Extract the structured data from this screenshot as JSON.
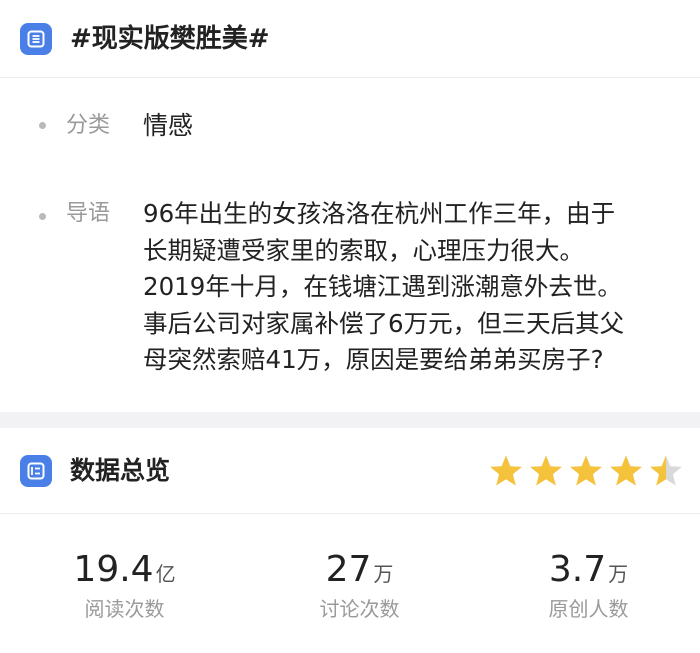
{
  "topic": {
    "title": "#现实版樊胜美#",
    "icon": "document-list-icon",
    "accent_color": "#4a7fe8"
  },
  "category": {
    "label": "分类",
    "value": "情感"
  },
  "intro": {
    "label": "导语",
    "lines": [
      "96年出生的女孩洛洛在杭州工作三年，由于",
      "长期疑遭受家里的索取，心理压力很大。",
      "2019年十月，在钱塘江遇到涨潮意外去世。",
      "事后公司对家属补偿了6万元，但三天后其父",
      "母突然索赔41万，原因是要给弟弟买房子?"
    ]
  },
  "overview": {
    "title": "数据总览",
    "icon": "list-chart-icon",
    "rating": {
      "stars": 4.5,
      "max": 5,
      "color": "#f5c33b",
      "empty_color": "#d9d9d9"
    }
  },
  "stats": [
    {
      "number": "19.4",
      "unit": "亿",
      "label": "阅读次数"
    },
    {
      "number": "27",
      "unit": "万",
      "label": "讨论次数"
    },
    {
      "number": "3.7",
      "unit": "万",
      "label": "原创人数"
    }
  ]
}
